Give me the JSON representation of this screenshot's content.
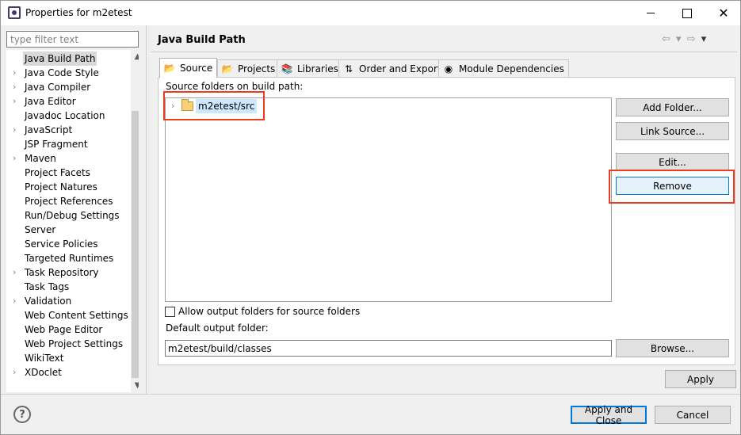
{
  "window": {
    "title": "Properties for m2etest",
    "minimize": "",
    "maximize": "",
    "close": "✕"
  },
  "filter": {
    "placeholder": "type filter text"
  },
  "tree": {
    "items": [
      {
        "label": "Java Build Path",
        "expandable": false,
        "selected": true
      },
      {
        "label": "Java Code Style",
        "expandable": true
      },
      {
        "label": "Java Compiler",
        "expandable": true
      },
      {
        "label": "Java Editor",
        "expandable": true
      },
      {
        "label": "Javadoc Location",
        "expandable": false
      },
      {
        "label": "JavaScript",
        "expandable": true
      },
      {
        "label": "JSP Fragment",
        "expandable": false
      },
      {
        "label": "Maven",
        "expandable": true
      },
      {
        "label": "Project Facets",
        "expandable": false
      },
      {
        "label": "Project Natures",
        "expandable": false
      },
      {
        "label": "Project References",
        "expandable": false
      },
      {
        "label": "Run/Debug Settings",
        "expandable": false
      },
      {
        "label": "Server",
        "expandable": false
      },
      {
        "label": "Service Policies",
        "expandable": false
      },
      {
        "label": "Targeted Runtimes",
        "expandable": false
      },
      {
        "label": "Task Repository",
        "expandable": true
      },
      {
        "label": "Task Tags",
        "expandable": false
      },
      {
        "label": "Validation",
        "expandable": true
      },
      {
        "label": "Web Content Settings",
        "expandable": false
      },
      {
        "label": "Web Page Editor",
        "expandable": false
      },
      {
        "label": "Web Project Settings",
        "expandable": false
      },
      {
        "label": "WikiText",
        "expandable": false
      },
      {
        "label": "XDoclet",
        "expandable": true
      }
    ]
  },
  "page": {
    "title": "Java Build Path",
    "nav": {
      "back": "⇦",
      "forward": "⇨",
      "menu": "▾"
    }
  },
  "tabs": [
    {
      "label": "Source",
      "icon": "source-folder-icon",
      "glyph": "📂",
      "active": true
    },
    {
      "label": "Projects",
      "icon": "projects-icon",
      "glyph": "📂"
    },
    {
      "label": "Libraries",
      "icon": "libraries-icon",
      "glyph": "📚"
    },
    {
      "label": "Order and Export",
      "icon": "order-export-icon",
      "glyph": "⇅"
    },
    {
      "label": "Module Dependencies",
      "icon": "module-icon",
      "glyph": "◉"
    }
  ],
  "source": {
    "section_label": "Source folders on build path:",
    "folders": [
      {
        "label": "m2etest/src"
      }
    ],
    "buttons": {
      "add_folder": "Add Folder...",
      "link_source": "Link Source...",
      "edit": "Edit...",
      "remove": "Remove"
    },
    "allow_output_label": "Allow output folders for source folders",
    "allow_output_checked": false,
    "default_output_label": "Default output folder:",
    "default_output_value": "m2etest/build/classes",
    "browse": "Browse..."
  },
  "footer": {
    "apply": "Apply",
    "apply_close": "Apply and Close",
    "cancel": "Cancel",
    "help": "?"
  },
  "colors": {
    "highlight": "#ea3c1e",
    "accent": "#0078d7",
    "selection": "#cce8ff"
  }
}
